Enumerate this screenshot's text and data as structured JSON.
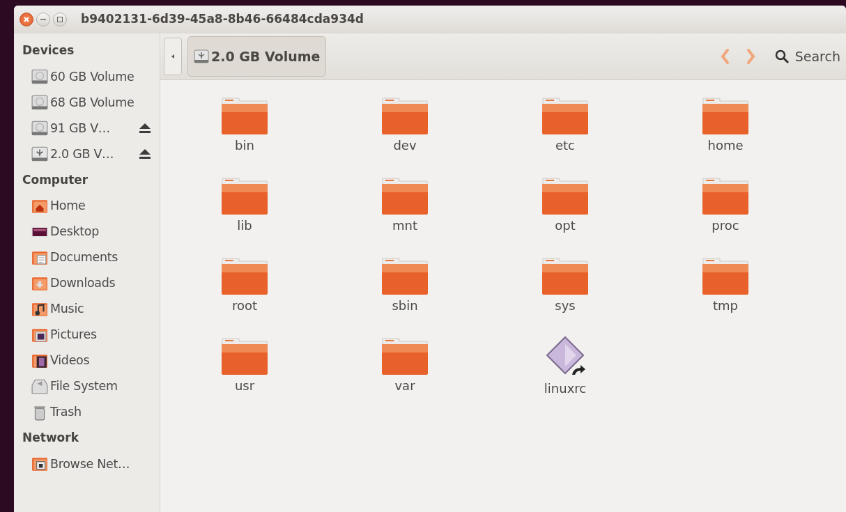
{
  "window": {
    "title": "b9402131-6d39-45a8-8b46-66484cda934d"
  },
  "sidebar": {
    "sections": [
      {
        "heading": "Devices",
        "items": [
          {
            "label": "60 GB Volume",
            "kind": "drive",
            "eject": false
          },
          {
            "label": "68 GB Volume",
            "kind": "drive",
            "eject": false
          },
          {
            "label": "91 GB V…",
            "kind": "drive",
            "eject": true
          },
          {
            "label": "2.0 GB V…",
            "kind": "usb",
            "eject": true
          }
        ]
      },
      {
        "heading": "Computer",
        "items": [
          {
            "label": "Home",
            "kind": "home",
            "eject": false
          },
          {
            "label": "Desktop",
            "kind": "desktop",
            "eject": false
          },
          {
            "label": "Documents",
            "kind": "documents",
            "eject": false
          },
          {
            "label": "Downloads",
            "kind": "downloads",
            "eject": false
          },
          {
            "label": "Music",
            "kind": "music",
            "eject": false
          },
          {
            "label": "Pictures",
            "kind": "pictures",
            "eject": false
          },
          {
            "label": "Videos",
            "kind": "videos",
            "eject": false
          },
          {
            "label": "File System",
            "kind": "filesystem",
            "eject": false
          },
          {
            "label": "Trash",
            "kind": "trash",
            "eject": false
          }
        ]
      },
      {
        "heading": "Network",
        "items": [
          {
            "label": "Browse Net…",
            "kind": "network",
            "eject": false
          }
        ]
      }
    ]
  },
  "toolbar": {
    "path": [
      {
        "label": "2.0 GB Volume",
        "kind": "usb",
        "selected": true
      }
    ],
    "search": "Search"
  },
  "files": [
    {
      "name": "bin",
      "kind": "folder"
    },
    {
      "name": "dev",
      "kind": "folder"
    },
    {
      "name": "etc",
      "kind": "folder"
    },
    {
      "name": "home",
      "kind": "folder"
    },
    {
      "name": "lib",
      "kind": "folder"
    },
    {
      "name": "mnt",
      "kind": "folder"
    },
    {
      "name": "opt",
      "kind": "folder"
    },
    {
      "name": "proc",
      "kind": "folder"
    },
    {
      "name": "root",
      "kind": "folder"
    },
    {
      "name": "sbin",
      "kind": "folder"
    },
    {
      "name": "sys",
      "kind": "folder"
    },
    {
      "name": "tmp",
      "kind": "folder"
    },
    {
      "name": "usr",
      "kind": "folder"
    },
    {
      "name": "var",
      "kind": "folder"
    },
    {
      "name": "linuxrc",
      "kind": "link"
    }
  ]
}
